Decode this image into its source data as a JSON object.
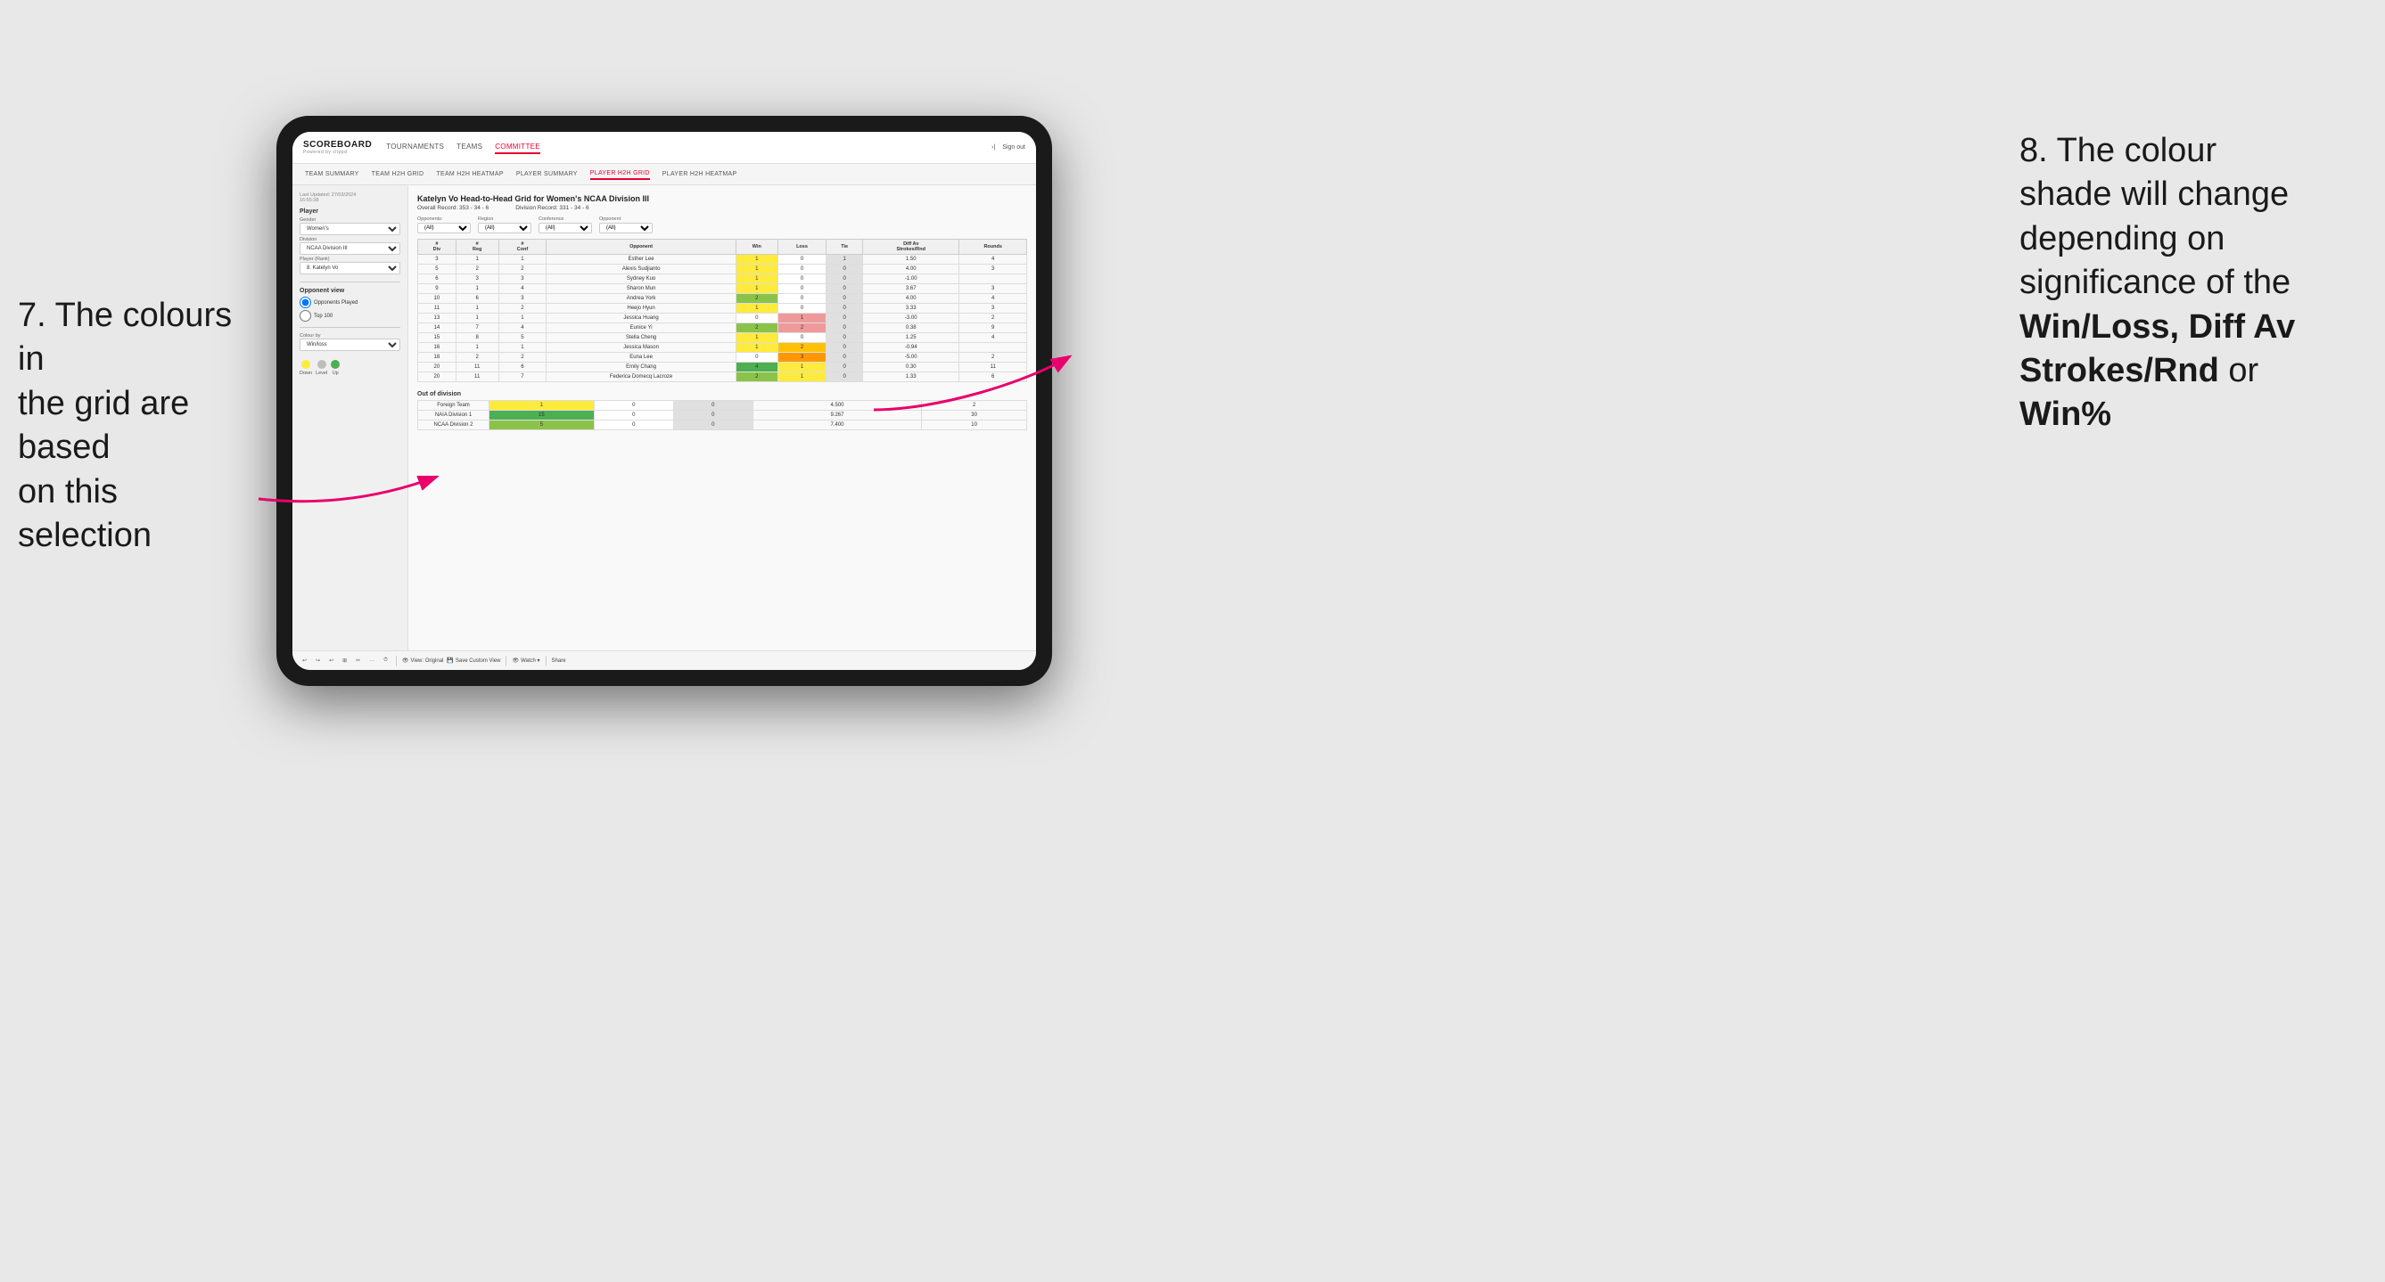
{
  "annotations": {
    "left": {
      "line1": "7. The colours in",
      "line2": "the grid are based",
      "line3": "on this selection"
    },
    "right": {
      "line1": "8. The colour",
      "line2": "shade will change",
      "line3": "depending on",
      "line4": "significance of the",
      "line5_bold": "Win/Loss, Diff Av",
      "line6_bold": "Strokes/Rnd",
      "line6_end": " or",
      "line7_bold": "Win%"
    }
  },
  "nav": {
    "logo": "SCOREBOARD",
    "logo_sub": "Powered by clippd",
    "items": [
      "TOURNAMENTS",
      "TEAMS",
      "COMMITTEE"
    ],
    "active_item": "COMMITTEE",
    "sign_in_icon": "›|",
    "sign_out": "Sign out"
  },
  "sub_nav": {
    "items": [
      "TEAM SUMMARY",
      "TEAM H2H GRID",
      "TEAM H2H HEATMAP",
      "PLAYER SUMMARY",
      "PLAYER H2H GRID",
      "PLAYER H2H HEATMAP"
    ],
    "active": "PLAYER H2H GRID"
  },
  "left_panel": {
    "last_updated_label": "Last Updated: 27/03/2024",
    "last_updated_time": "16:55:38",
    "player_section": "Player",
    "gender_label": "Gender",
    "gender_value": "Women's",
    "division_label": "Division",
    "division_value": "NCAA Division III",
    "player_rank_label": "Player (Rank)",
    "player_rank_value": "8. Katelyn Vo",
    "opponent_view_label": "Opponent view",
    "radio_opponents": "Opponents Played",
    "radio_top100": "Top 100",
    "colour_by_label": "Colour by",
    "colour_by_value": "Win/loss",
    "legend": {
      "down_label": "Down",
      "level_label": "Level",
      "up_label": "Up"
    }
  },
  "grid": {
    "title": "Katelyn Vo Head-to-Head Grid for Women's NCAA Division III",
    "overall_record_label": "Overall Record:",
    "overall_record": "353 - 34 - 6",
    "division_record_label": "Division Record:",
    "division_record": "331 - 34 - 6",
    "opponents_label": "Opponents:",
    "opponents_value": "(All)",
    "region_label": "Region",
    "conference_label": "Conference",
    "opponent_label": "Opponent",
    "region_value": "(All)",
    "conference_value": "(All)",
    "opponent_value": "(All)",
    "columns": [
      "#\nDiv",
      "#\nReg",
      "#\nConf",
      "Opponent",
      "Win",
      "Loss",
      "Tie",
      "Diff Av\nStrokes/Rnd",
      "Rounds"
    ],
    "rows": [
      {
        "div": "3",
        "reg": "1",
        "conf": "1",
        "opponent": "Esther Lee",
        "win": "1",
        "loss": "0",
        "tie": "1",
        "diff": "1.50",
        "rounds": "4",
        "win_color": "yellow",
        "loss_color": "white",
        "tie_color": "grey"
      },
      {
        "div": "5",
        "reg": "2",
        "conf": "2",
        "opponent": "Alexis Sudjianto",
        "win": "1",
        "loss": "0",
        "tie": "0",
        "diff": "4.00",
        "rounds": "3",
        "win_color": "yellow",
        "loss_color": "white",
        "tie_color": "grey"
      },
      {
        "div": "6",
        "reg": "3",
        "conf": "3",
        "opponent": "Sydney Kuo",
        "win": "1",
        "loss": "0",
        "tie": "0",
        "diff": "-1.00",
        "rounds": "",
        "win_color": "yellow",
        "loss_color": "white",
        "tie_color": "grey"
      },
      {
        "div": "9",
        "reg": "1",
        "conf": "4",
        "opponent": "Sharon Mun",
        "win": "1",
        "loss": "0",
        "tie": "0",
        "diff": "3.67",
        "rounds": "3",
        "win_color": "yellow",
        "loss_color": "white",
        "tie_color": "grey"
      },
      {
        "div": "10",
        "reg": "6",
        "conf": "3",
        "opponent": "Andrea York",
        "win": "2",
        "loss": "0",
        "tie": "0",
        "diff": "4.00",
        "rounds": "4",
        "win_color": "green_mid",
        "loss_color": "white",
        "tie_color": "grey"
      },
      {
        "div": "11",
        "reg": "1",
        "conf": "2",
        "opponent": "Heejo Hyun",
        "win": "1",
        "loss": "0",
        "tie": "0",
        "diff": "3.33",
        "rounds": "3",
        "win_color": "yellow",
        "loss_color": "white",
        "tie_color": "grey"
      },
      {
        "div": "13",
        "reg": "1",
        "conf": "1",
        "opponent": "Jessica Huang",
        "win": "0",
        "loss": "1",
        "tie": "0",
        "diff": "-3.00",
        "rounds": "2",
        "win_color": "white",
        "loss_color": "red_light",
        "tie_color": "grey"
      },
      {
        "div": "14",
        "reg": "7",
        "conf": "4",
        "opponent": "Eunice Yi",
        "win": "2",
        "loss": "2",
        "tie": "0",
        "diff": "0.38",
        "rounds": "9",
        "win_color": "green_mid",
        "loss_color": "red_light",
        "tie_color": "grey"
      },
      {
        "div": "15",
        "reg": "8",
        "conf": "5",
        "opponent": "Stella Cheng",
        "win": "1",
        "loss": "0",
        "tie": "0",
        "diff": "1.25",
        "rounds": "4",
        "win_color": "yellow",
        "loss_color": "white",
        "tie_color": "grey"
      },
      {
        "div": "16",
        "reg": "1",
        "conf": "1",
        "opponent": "Jessica Mason",
        "win": "1",
        "loss": "2",
        "tie": "0",
        "diff": "-0.94",
        "rounds": "",
        "win_color": "yellow",
        "loss_color": "orange_light",
        "tie_color": "grey"
      },
      {
        "div": "18",
        "reg": "2",
        "conf": "2",
        "opponent": "Euna Lee",
        "win": "0",
        "loss": "3",
        "tie": "0",
        "diff": "-5.00",
        "rounds": "2",
        "win_color": "white",
        "loss_color": "orange",
        "tie_color": "grey"
      },
      {
        "div": "20",
        "reg": "11",
        "conf": "6",
        "opponent": "Emily Chang",
        "win": "4",
        "loss": "1",
        "tie": "0",
        "diff": "0.30",
        "rounds": "11",
        "win_color": "green_dark",
        "loss_color": "yellow",
        "tie_color": "grey"
      },
      {
        "div": "20",
        "reg": "11",
        "conf": "7",
        "opponent": "Federica Domecq Lacroze",
        "win": "2",
        "loss": "1",
        "tie": "0",
        "diff": "1.33",
        "rounds": "6",
        "win_color": "green_mid",
        "loss_color": "yellow",
        "tie_color": "grey"
      }
    ],
    "out_of_division_label": "Out of division",
    "ood_rows": [
      {
        "label": "Foreign Team",
        "win": "1",
        "loss": "0",
        "tie": "0",
        "diff": "4.500",
        "rounds": "2",
        "win_color": "yellow",
        "loss_color": "white",
        "tie_color": "grey"
      },
      {
        "label": "NAIA Division 1",
        "win": "15",
        "loss": "0",
        "tie": "0",
        "diff": "9.267",
        "rounds": "30",
        "win_color": "green_dark",
        "loss_color": "white",
        "tie_color": "grey"
      },
      {
        "label": "NCAA Division 2",
        "win": "5",
        "loss": "0",
        "tie": "0",
        "diff": "7.400",
        "rounds": "10",
        "win_color": "green_mid",
        "loss_color": "white",
        "tie_color": "grey"
      }
    ]
  },
  "toolbar": {
    "buttons": [
      "↩",
      "↪",
      "↩",
      "⊞",
      "✂",
      "·",
      "⏱",
      "|",
      "View: Original",
      "Save Custom View",
      "Watch ▾",
      "|",
      "Share"
    ],
    "view_original": "View: Original",
    "save_custom": "Save Custom View",
    "watch": "Watch ▾",
    "share": "Share"
  }
}
